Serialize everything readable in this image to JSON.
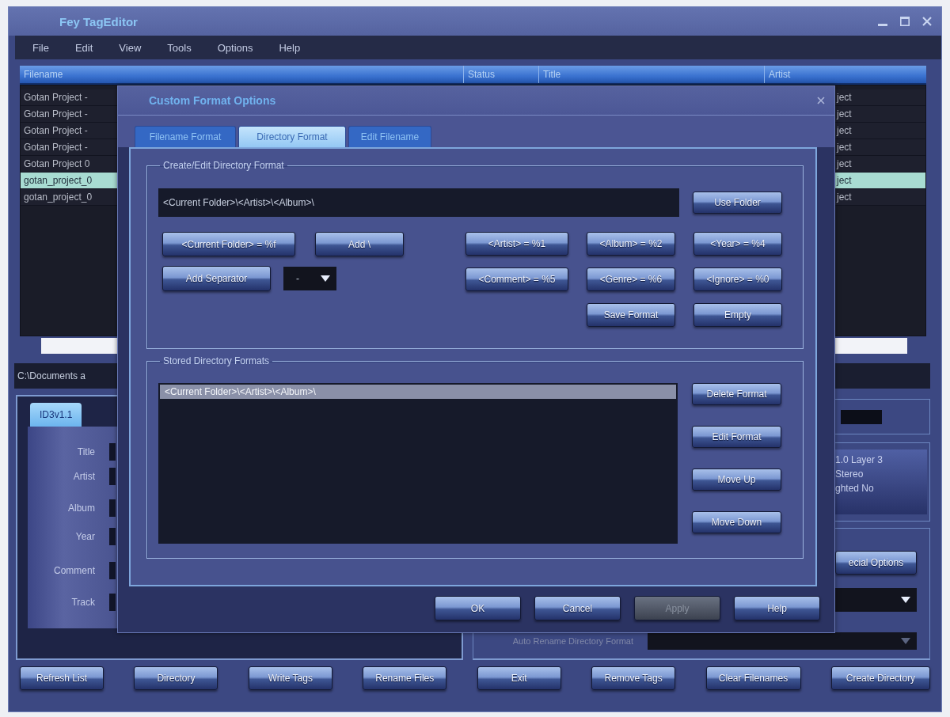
{
  "window": {
    "title": "Fey TagEditor"
  },
  "menu": [
    "File",
    "Edit",
    "View",
    "Tools",
    "Options",
    "Help"
  ],
  "file_list": {
    "columns": [
      "Filename",
      "Status",
      "Title",
      "Artist"
    ],
    "rows": [
      {
        "filename": "Gotan Project -",
        "artist": "ject",
        "selected": false
      },
      {
        "filename": "Gotan Project -",
        "artist": "ject",
        "selected": false
      },
      {
        "filename": "Gotan Project -",
        "artist": "ject",
        "selected": false
      },
      {
        "filename": "Gotan Project -",
        "artist": "ject",
        "selected": false
      },
      {
        "filename": "Gotan Project 0",
        "artist": "ject",
        "selected": false
      },
      {
        "filename": "gotan_project_0",
        "artist": "ject",
        "selected": true
      },
      {
        "filename": "gotan_project_0",
        "artist": "ject",
        "selected": false
      }
    ]
  },
  "path": "C:\\Documents a",
  "tag_panel": {
    "tabs": [
      {
        "label": "ID3v1.1",
        "selected": true
      }
    ],
    "fields": [
      "Title",
      "Artist",
      "Album",
      "Year",
      "Comment",
      "Track"
    ]
  },
  "audio_info": {
    "lines": [
      "1.0 Layer 3",
      "Stereo",
      "ghted No"
    ],
    "options_button": "ecial Options",
    "format_label": "Auto Rename Directory Format"
  },
  "buttons": [
    "Refresh List",
    "Directory",
    "Write Tags",
    "Rename Files",
    "Exit",
    "Remove Tags",
    "Clear Filenames",
    "Create Directory"
  ],
  "dialog": {
    "title": "Custom Format Options",
    "tabs": [
      {
        "label": "Filename Format",
        "selected": false
      },
      {
        "label": "Directory Format",
        "selected": true
      },
      {
        "label": "Edit Filename",
        "selected": false
      }
    ],
    "create_group": {
      "title": "Create/Edit Directory Format",
      "value": "<Current Folder>\\<Artist>\\<Album>\\",
      "use_folder": "Use Folder",
      "current_folder": "<Current Folder> = %f",
      "add_slash": "Add \\",
      "add_separator": "Add Separator",
      "separator_value": "-",
      "tokens": [
        "<Artist> = %1",
        "<Album> = %2",
        "<Year> = %4",
        "<Comment> = %5",
        "<Genre> = %6",
        "<Ignore> = %0"
      ],
      "save": "Save Format",
      "empty": "Empty"
    },
    "stored_group": {
      "title": "Stored Directory Formats",
      "items": [
        {
          "text": "<Current Folder>\\<Artist>\\<Album>\\",
          "selected": true
        }
      ],
      "buttons": [
        "Delete Format",
        "Edit Format",
        "Move Up",
        "Move Down"
      ]
    },
    "footer": [
      {
        "label": "OK",
        "disabled": false
      },
      {
        "label": "Cancel",
        "disabled": false
      },
      {
        "label": "Apply",
        "disabled": true
      },
      {
        "label": "Help",
        "disabled": false
      }
    ]
  }
}
